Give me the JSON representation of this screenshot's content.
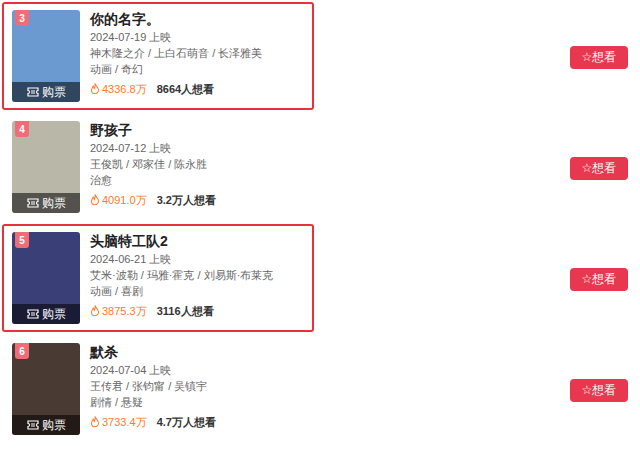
{
  "movies": [
    {
      "rank": "3",
      "title": "你的名字。",
      "date": "2024-07-19 上映",
      "cast": "神木隆之介 / 上白石萌音 / 长泽雅美",
      "genre": "动画 / 奇幻",
      "heat": "4336.8万",
      "want": "8664人想看",
      "buy": "购票",
      "button_icon": "☆",
      "button": "想看",
      "highlighted": true,
      "color": "#6a9ad0"
    },
    {
      "rank": "4",
      "title": "野孩子",
      "date": "2024-07-12 上映",
      "cast": "王俊凯 / 邓家佳 / 陈永胜",
      "genre": "治愈",
      "heat": "4091.0万",
      "want": "3.2万人想看",
      "buy": "购票",
      "button_icon": "☆",
      "button": "想看",
      "highlighted": false,
      "color": "#b9b7a8"
    },
    {
      "rank": "5",
      "title": "头脑特工队2",
      "date": "2024-06-21 上映",
      "cast": "艾米·波勒 / 玛雅·霍克 / 刘易斯·布莱克",
      "genre": "动画 / 喜剧",
      "heat": "3875.3万",
      "want": "3116人想看",
      "buy": "购票",
      "button_icon": "☆",
      "button": "想看",
      "highlighted": true,
      "color": "#3a3f78"
    },
    {
      "rank": "6",
      "title": "默杀",
      "date": "2024-07-04 上映",
      "cast": "王传君 / 张钧甯 / 吴镇宇",
      "genre": "剧情 / 悬疑",
      "heat": "3733.4万",
      "want": "4.7万人想看",
      "buy": "购票",
      "button_icon": "☆",
      "button": "想看",
      "highlighted": false,
      "color": "#4a3a34"
    }
  ]
}
